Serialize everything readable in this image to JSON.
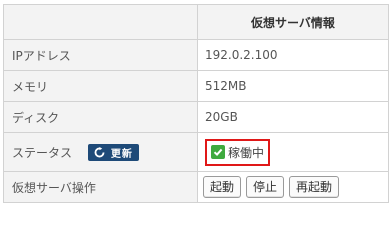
{
  "header": {
    "title": "仮想サーバ情報"
  },
  "rows": [
    {
      "label": "IPアドレス",
      "value": "192.0.2.100"
    },
    {
      "label": "メモリ",
      "value": "512MB"
    },
    {
      "label": "ディスク",
      "value": "20GB"
    }
  ],
  "status": {
    "label": "ステータス",
    "refresh_label": "更新",
    "value": "稼働中",
    "check_icon": "checkbox-icon",
    "refresh_icon": "refresh-icon"
  },
  "operations": {
    "label": "仮想サーバ操作",
    "start": "起動",
    "stop": "停止",
    "restart": "再起動"
  },
  "colors": {
    "refresh_bg": "#1e4a78",
    "highlight": "#e01818",
    "check": "#3eaa3e"
  }
}
